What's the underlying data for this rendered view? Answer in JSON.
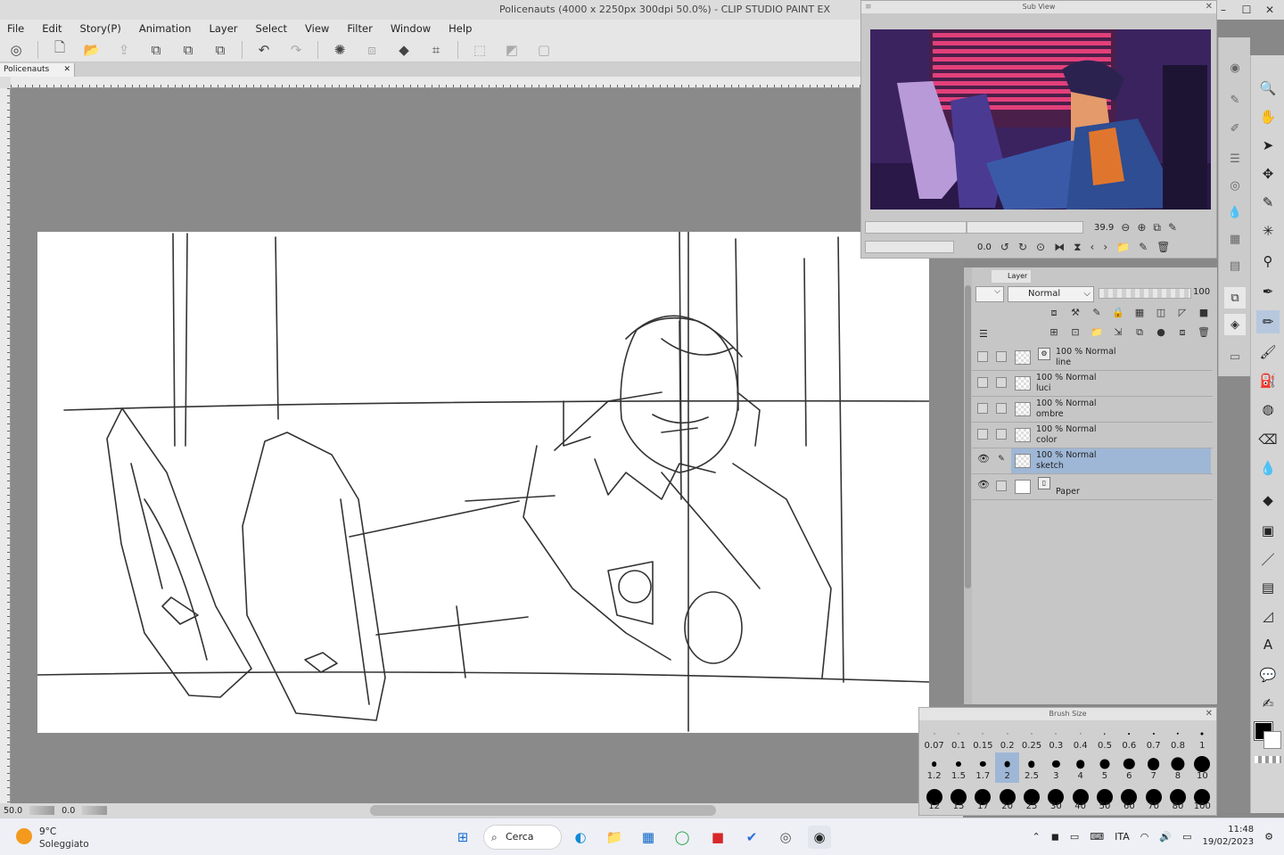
{
  "window": {
    "title": "Policenauts (4000 x 2250px 300dpi 50.0%)  - CLIP STUDIO PAINT EX"
  },
  "menu": [
    "File",
    "Edit",
    "Story(P)",
    "Animation",
    "Layer",
    "Select",
    "View",
    "Filter",
    "Window",
    "Help"
  ],
  "document_tab": {
    "name": "Policenauts",
    "close": "✕"
  },
  "status": {
    "zoom": "50.0",
    "rotation": "0.0"
  },
  "subview": {
    "title": "Sub View",
    "zoom": "39.9",
    "rotation": "0.0"
  },
  "layer_panel": {
    "tab": "Layer",
    "blend_mode": "Normal",
    "opacity": "100",
    "layers": [
      {
        "mode": "100 % Normal",
        "name": "line",
        "visible": false,
        "selected": false,
        "thumb": "transparent",
        "extra": true
      },
      {
        "mode": "100 % Normal",
        "name": "luci",
        "visible": false,
        "selected": false,
        "thumb": "transparent",
        "extra": false
      },
      {
        "mode": "100 % Normal",
        "name": "ombre",
        "visible": false,
        "selected": false,
        "thumb": "transparent",
        "extra": false
      },
      {
        "mode": "100 % Normal",
        "name": "color",
        "visible": false,
        "selected": false,
        "thumb": "transparent",
        "extra": false
      },
      {
        "mode": "100 % Normal",
        "name": "sketch",
        "visible": true,
        "selected": true,
        "thumb": "transparent",
        "extra": false
      },
      {
        "mode": "",
        "name": "Paper",
        "visible": true,
        "selected": false,
        "thumb": "white",
        "extra": true
      }
    ]
  },
  "brush_size": {
    "title": "Brush Size",
    "row1": [
      "0.07",
      "0.1",
      "0.15",
      "0.2",
      "0.25",
      "0.3",
      "0.4",
      "0.5",
      "0.6",
      "0.7",
      "0.8",
      "1"
    ],
    "row2": [
      "1.2",
      "1.5",
      "1.7",
      "2",
      "2.5",
      "3",
      "4",
      "5",
      "6",
      "7",
      "8",
      "10"
    ],
    "row3": [
      "12",
      "15",
      "17",
      "20",
      "25",
      "30",
      "40",
      "50",
      "60",
      "70",
      "80",
      "100"
    ],
    "selected": "2"
  },
  "taskbar": {
    "temperature": "9°C",
    "weather": "Soleggiato",
    "search": "Cerca",
    "language": "ITA",
    "time": "11:48",
    "date": "19/02/2023"
  },
  "colors": {
    "accent": "#9fb7d6",
    "foreground": "#000000",
    "background": "#ffffff"
  }
}
